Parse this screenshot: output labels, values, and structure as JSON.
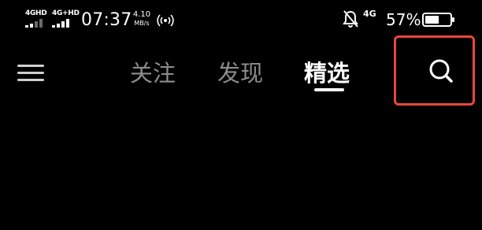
{
  "status_bar": {
    "sim1_network": "4GHD",
    "sim1_signal_level": 0.5,
    "sim2_network": "4G+HD",
    "sim2_signal_level": 1.0,
    "time": "07:37",
    "net_speed_value": "4.10",
    "net_speed_unit": "MB/s",
    "hotspot_icon": "wifi-hotspot-icon",
    "dnd_icon": "bell-off-icon",
    "mobile_data": "4G",
    "battery_percent": "57%",
    "battery_level": 0.57
  },
  "top_nav": {
    "menu_icon": "hamburger-menu-icon",
    "tabs": [
      {
        "label": "关注",
        "active": false
      },
      {
        "label": "发现",
        "active": false
      },
      {
        "label": "精选",
        "active": true
      }
    ],
    "search_icon": "search-icon",
    "colors": {
      "active_tab": "#ffffff",
      "inactive_tab": "#8c8c8c",
      "highlight": "#e8473b",
      "background": "#000000"
    }
  }
}
